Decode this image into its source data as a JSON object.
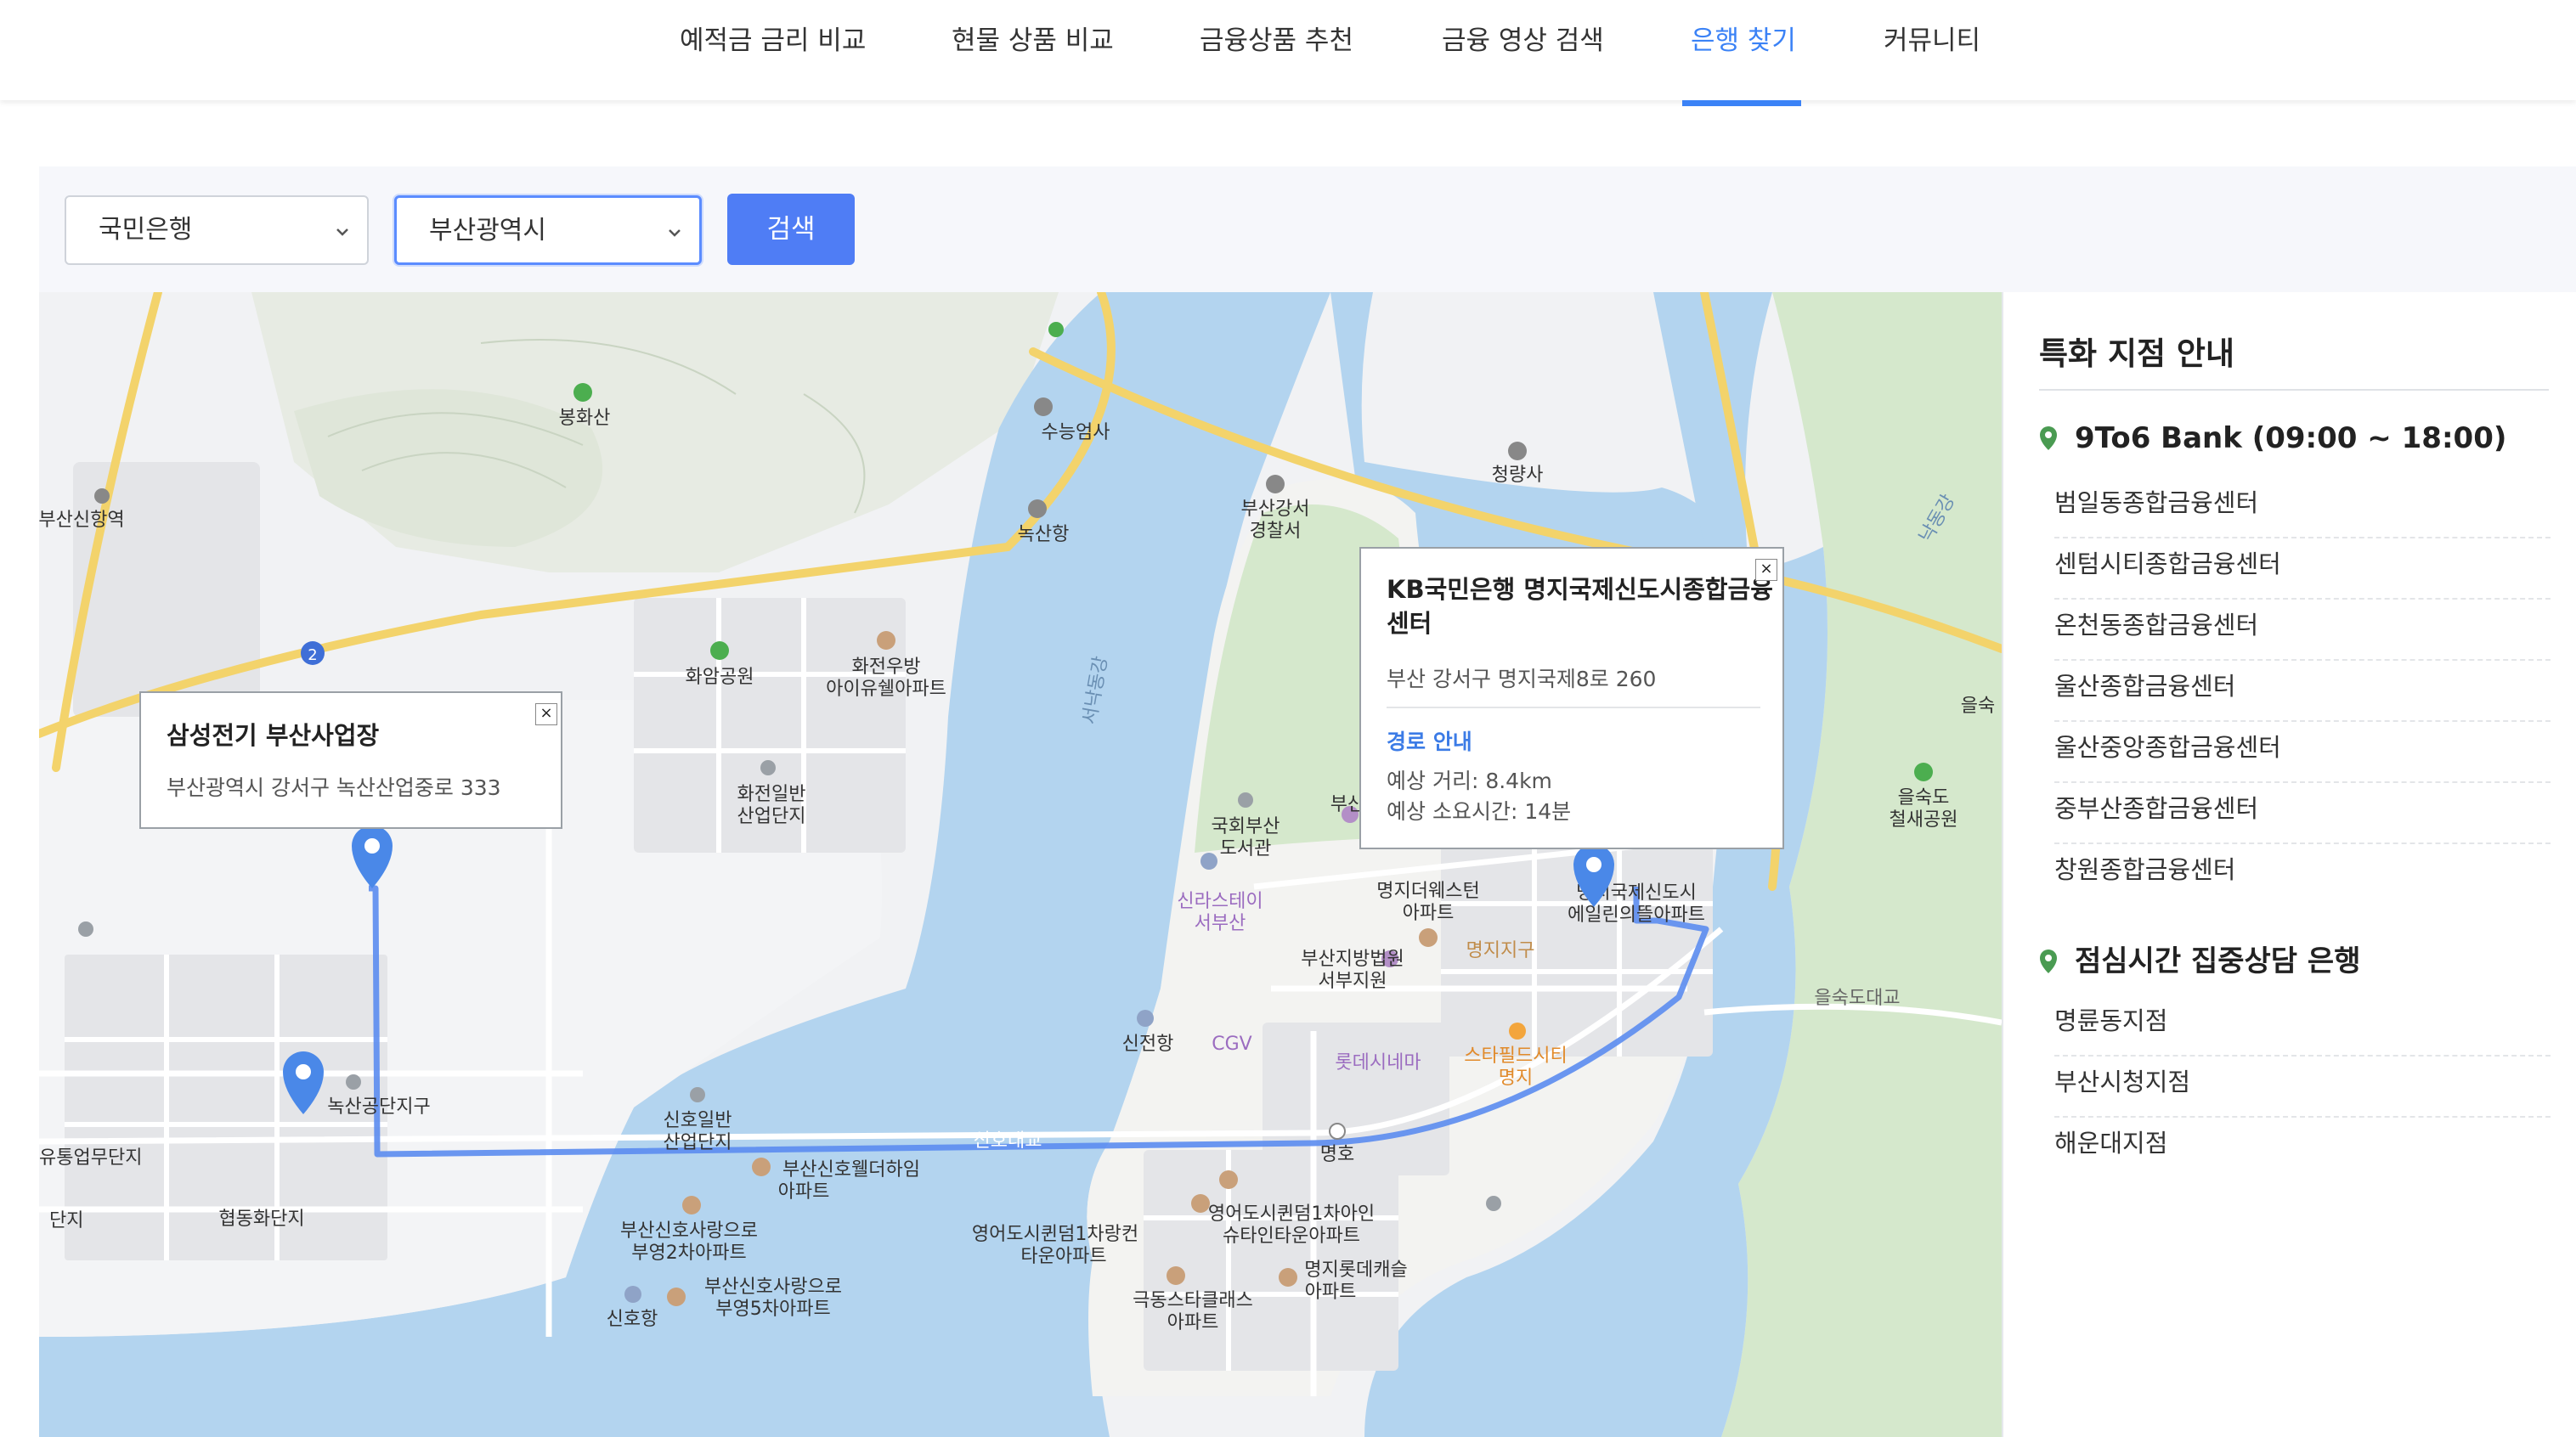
{
  "nav": {
    "items": [
      {
        "label": "예적금 금리 비교"
      },
      {
        "label": "현물 상품 비교"
      },
      {
        "label": "금융상품 추천"
      },
      {
        "label": "금융 영상 검색"
      },
      {
        "label": "은행 찾기"
      },
      {
        "label": "커뮤니티"
      }
    ],
    "active_index": 4
  },
  "filters": {
    "bank_select": "국민은행",
    "region_select": "부산광역시",
    "search_label": "검색"
  },
  "colors": {
    "accent": "#3b82f6",
    "button": "#4f7df5",
    "route": "#5b8cf0",
    "water": "#b3d4ef",
    "park": "#d5e8cc"
  },
  "map": {
    "popup_origin": {
      "title": "삼성전기 부산사업장",
      "address": "부산광역시 강서구 녹산산업중로 333",
      "close": "×"
    },
    "popup_dest": {
      "title_line1": "KB국민은행 명지국제신도시종합금융",
      "title_line2": "센터",
      "address": "부산 강서구 명지국제8로 260",
      "route_link": "경로 안내",
      "distance": "예상 거리: 8.4km",
      "duration": "예상 소요시간: 14분",
      "close": "×"
    },
    "labels": {
      "l1": "봉화산",
      "l2": "부산신항역",
      "l3": "수능엄사",
      "l4": "녹산항",
      "l5": "부산강서",
      "l6": "경찰서",
      "l7": "청량사",
      "l8": "화암공원",
      "l9": "화전우방",
      "l10": "아이유쉘아파트",
      "l11": "화전일반",
      "l12": "산업단지",
      "l13": "국회부산",
      "l14": "도서관",
      "l15": "신라스테이",
      "l16": "서부산",
      "l17": "명지더웨스턴",
      "l18": "아파트",
      "l19": "명지국제신도시",
      "l20": "에일린의뜰아파트",
      "l21": "명지지구",
      "l22": "부산지방법원",
      "l23": "서부지원",
      "l24": "신전항",
      "l25": "CGV",
      "l26": "롯데시네마",
      "l27": "스타필드시티",
      "l28": "명지",
      "l29": "녹산공단지구",
      "l30": "유통업무단지",
      "l31": "신호일반",
      "l32": "산업단지",
      "l33": "부산신호웰더하임",
      "l34": "아파트",
      "l35": "신호대교",
      "l36": "명호",
      "l37": "협동화단지",
      "l38": "부산신호사랑으로",
      "l39": "부영2차아파트",
      "l40": "부산신호사랑으로",
      "l41": "부영5차아파트",
      "l42": "신호항",
      "l43": "영어도시퀸덤1차랑컨",
      "l44": "타운아파트",
      "l45": "영어도시퀸덤1차아인",
      "l46": "슈타인타운아파트",
      "l47": "극동스타클래스",
      "l48": "아파트",
      "l49": "명지롯데캐슬",
      "l50": "아파트",
      "l51": "을숙도",
      "l52": "철새공원",
      "l53": "을숙도대교",
      "l54": "을숙",
      "l55": "낙동강",
      "l56": "서낙동강",
      "l57": "2",
      "l58": "단지",
      "l59": "부산"
    }
  },
  "sidebar": {
    "title": "특화 지점 안내",
    "section1": {
      "heading": "9To6 Bank (09:00 ~ 18:00)",
      "items": [
        "범일동종합금융센터",
        "센텀시티종합금융센터",
        "온천동종합금융센터",
        "울산종합금융센터",
        "울산중앙종합금융센터",
        "중부산종합금융센터",
        "창원종합금융센터"
      ]
    },
    "section2": {
      "heading": "점심시간 집중상담 은행",
      "items": [
        "명륜동지점",
        "부산시청지점",
        "해운대지점"
      ]
    }
  }
}
